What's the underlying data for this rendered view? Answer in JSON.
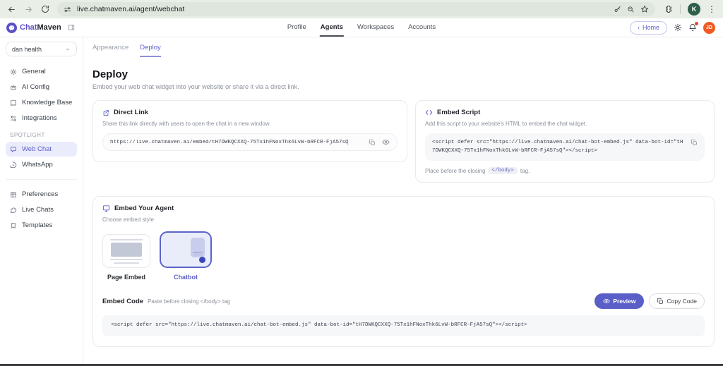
{
  "colors": {
    "accent": "#5b5fc7",
    "accent_border": "#5c63c9",
    "active_item_bg": "#eaebfb",
    "selected_tile_bg": "#e9ecf9",
    "launcher_blue": "#3b47b8",
    "avatar_orange": "#f25a22",
    "browser_avatar_green": "#2d5f4c",
    "notification_red": "#e8442e",
    "toolbar_bg": "#e9eee6"
  },
  "browser": {
    "url": "live.chatmaven.ai/agent/webchat",
    "profile_initial": "K"
  },
  "header": {
    "brand_chat": "Chat",
    "brand_maven": "Maven",
    "nav": [
      {
        "label": "Profile"
      },
      {
        "label": "Agents"
      },
      {
        "label": "Workspaces"
      },
      {
        "label": "Accounts"
      }
    ],
    "home_chevron": "‹",
    "home_label": "Home",
    "avatar_initials": "JD"
  },
  "sidebar": {
    "workspace": "dan health",
    "section_label": "SPOTLIGHT",
    "items": {
      "general": "General",
      "ai_config": "AI Config",
      "knowledge_base": "Knowledge Base",
      "integrations": "Integrations",
      "web_chat": "Web Chat",
      "whatsapp": "WhatsApp",
      "preferences": "Preferences",
      "live_chats": "Live Chats",
      "templates": "Templates"
    }
  },
  "tabs": {
    "appearance": "Appearance",
    "deploy": "Deploy"
  },
  "page": {
    "title": "Deploy",
    "subtitle": "Embed your web chat widget into your website or share it via a direct link."
  },
  "direct_link": {
    "title": "Direct Link",
    "description": "Share this link directly with users to open the chat in a new window.",
    "url": "https://live.chatmaven.ai/embed/tH7DWKQCXXQ-75Tx1hFNoxThk6LvW-bRFCR-FjA57sQ"
  },
  "embed_script": {
    "title": "Embed Script",
    "description": "Add this script to your website's HTML to embed the chat widget.",
    "code": "<script defer src=\"https://live.chatmaven.ai/chat-bot-embed.js\" data-bot-id=\"tH7DWKQCXXQ-75Tx1hFNoxThk6LvW-bRFCR-FjA57sQ\"></script>",
    "note_prefix": "Place before the closing",
    "note_tag": "</body>",
    "note_suffix": "tag."
  },
  "embed_agent": {
    "title": "Embed Your Agent",
    "subtitle": "Choose embed style",
    "options": [
      {
        "label": "Page Embed"
      },
      {
        "label": "Chatbot"
      }
    ],
    "embed_code_label": "Embed Code",
    "embed_code_hint": "Paste before closing </body> tag",
    "preview_label": "Preview",
    "copy_code_label": "Copy Code",
    "code": "<script defer src=\"https://live.chatmaven.ai/chat-bot-embed.js\" data-bot-id=\"tH7DWKQCXXQ-75Tx1hFNoxThk6LvW-bRFCR-FjA57sQ\"></script>"
  }
}
